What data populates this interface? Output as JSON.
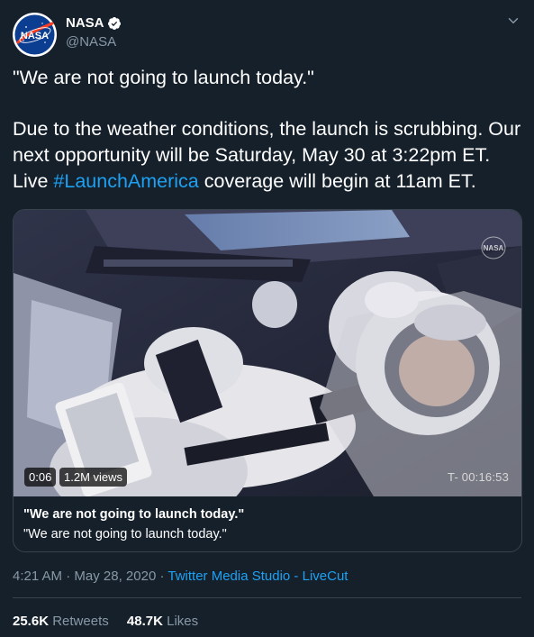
{
  "account": {
    "display_name": "NASA",
    "handle": "@NASA",
    "avatar_text": "NASA",
    "verified": true
  },
  "tweet": {
    "quote_line": "\"We are not going to launch today.\"",
    "body_before_hashtag": "Due to the weather conditions, the launch is scrubbing. Our next opportunity will be Saturday, May 30 at 3:22pm ET. Live ",
    "hashtag": "#LaunchAmerica",
    "body_after_hashtag": " coverage will begin at 11am ET."
  },
  "media": {
    "video_time": "0:06",
    "views": "1.2M views",
    "countdown": "T- 00:16:53",
    "watermark_text": "NASA",
    "card_title": "\"We are not going to launch today.\"",
    "card_description": "\"We are not going to launch today.\""
  },
  "meta": {
    "time": "4:21 AM",
    "separator": "·",
    "date": "May 28, 2020",
    "source": "Twitter Media Studio - LiveCut"
  },
  "stats": {
    "retweets_count": "25.6K",
    "retweets_label": "Retweets",
    "likes_count": "48.7K",
    "likes_label": "Likes"
  },
  "colors": {
    "background": "#15202b",
    "link": "#1da1f2",
    "secondary_text": "#8899a6",
    "border": "#38444d"
  },
  "icons": {
    "verified": "verified-badge-icon",
    "more": "chevron-down-icon"
  }
}
